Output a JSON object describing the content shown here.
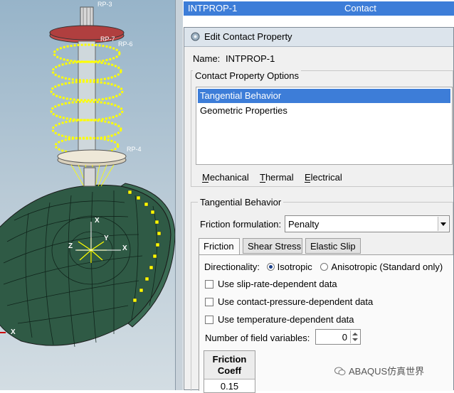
{
  "viewport": {
    "labels": {
      "rp3": "RP-3",
      "rp7": "RP-7",
      "rp6": "RP-6",
      "rp4": "RP-4",
      "x": "X",
      "y": "Y",
      "z": "Z"
    }
  },
  "contact_list": {
    "name": "INTPROP-1",
    "type": "Contact"
  },
  "dialog": {
    "title": "Edit Contact Property",
    "name_label": "Name:",
    "name_value": "INTPROP-1",
    "options_title": "Contact Property Options",
    "options": [
      "Tangential Behavior",
      "Geometric Properties"
    ],
    "menus": [
      "Mechanical",
      "Thermal",
      "Electrical"
    ],
    "section_title": "Tangential Behavior",
    "friction_formulation_label": "Friction formulation:",
    "friction_formulation_value": "Penalty",
    "tabs": [
      "Friction",
      "Shear Stress",
      "Elastic Slip"
    ],
    "directionality_label": "Directionality:",
    "directionality_options": [
      "Isotropic",
      "Anisotropic (Standard only)"
    ],
    "checkboxes": [
      "Use slip-rate-dependent data",
      "Use contact-pressure-dependent data",
      "Use temperature-dependent data"
    ],
    "field_vars_label": "Number of field variables:",
    "field_vars_value": "0",
    "table_header_1": "Friction",
    "table_header_2": "Coeff",
    "table_value": "0.15"
  },
  "watermark": "ABAQUS仿真世界",
  "colors": {
    "selection": "#3d7dd8",
    "mesh": "#2f5a45",
    "spring": "#ffff00",
    "cap": "#c24a4a"
  }
}
